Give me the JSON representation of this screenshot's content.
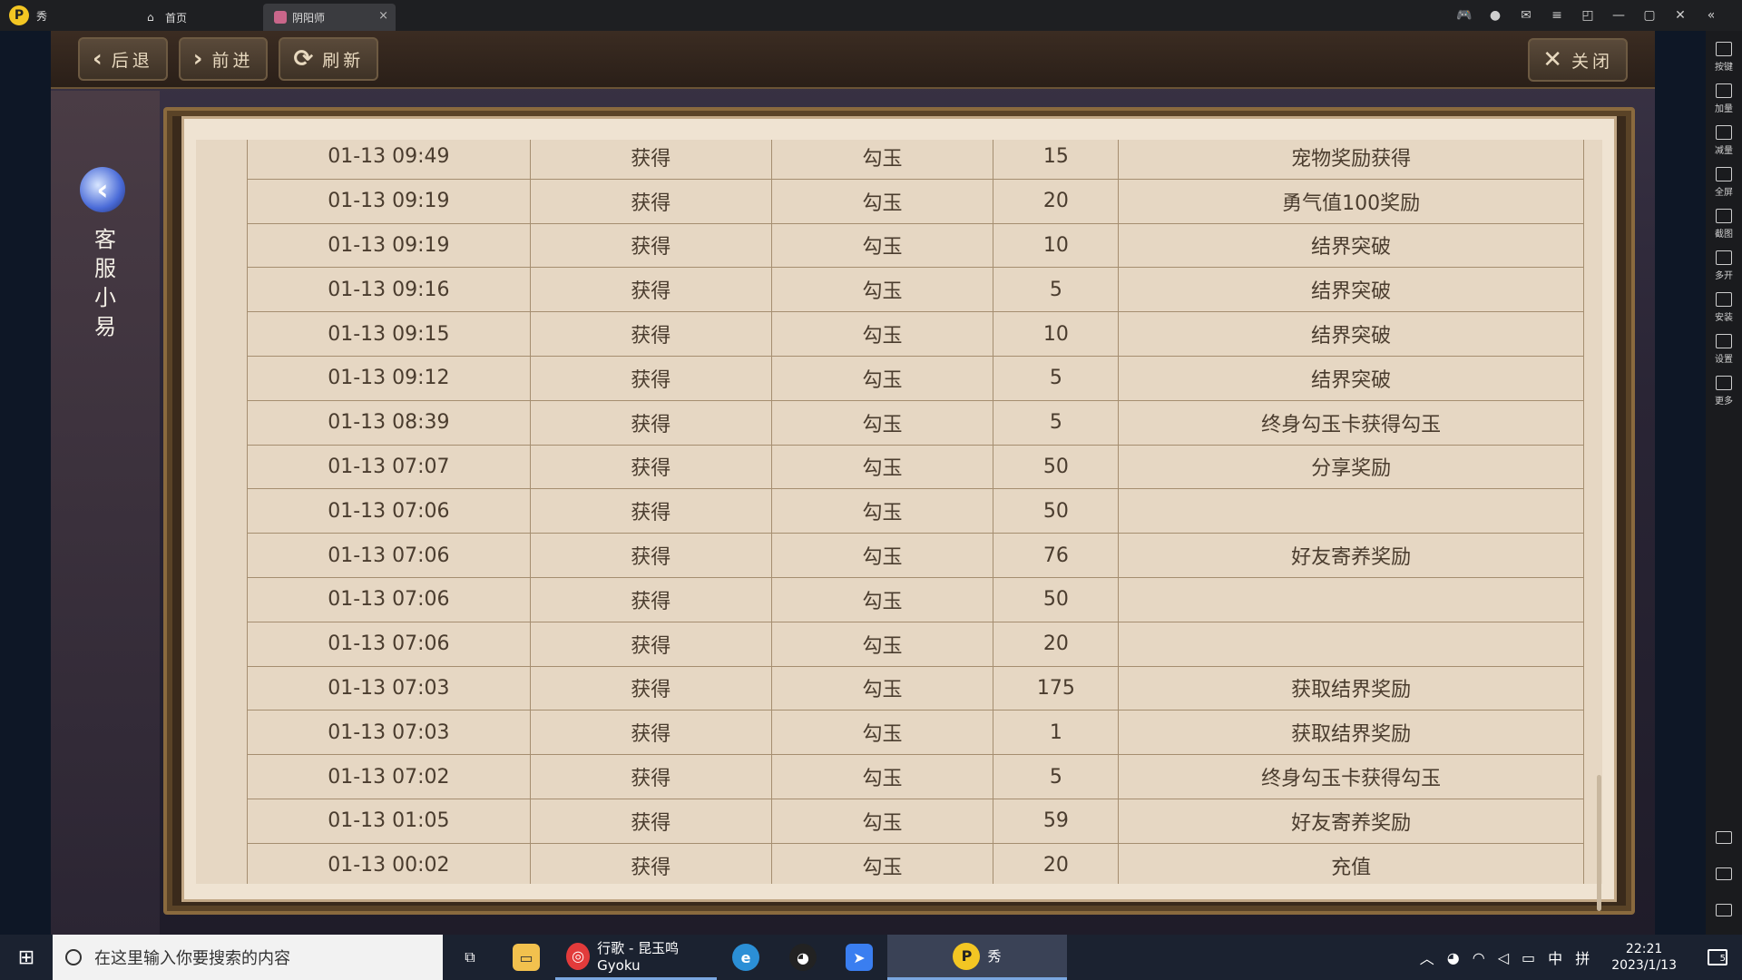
{
  "emulator": {
    "name": "秀",
    "tabs": [
      {
        "label": "首页"
      },
      {
        "label": "阴阳师"
      }
    ],
    "tab_close": "×"
  },
  "side_tools": [
    {
      "label": "按键"
    },
    {
      "label": "加量"
    },
    {
      "label": "减量"
    },
    {
      "label": "全屏"
    },
    {
      "label": "截图"
    },
    {
      "label": "多开"
    },
    {
      "label": "安装"
    },
    {
      "label": "设置"
    },
    {
      "label": "更多"
    }
  ],
  "header": {
    "back_label": "后退",
    "forward_label": "前进",
    "refresh_label": "刷新",
    "close_label": "关闭"
  },
  "left": {
    "cs_label": "客服小易"
  },
  "records": [
    [
      "01-13 09:49",
      "获得",
      "勾玉",
      "15",
      "宠物奖励获得"
    ],
    [
      "01-13 09:19",
      "获得",
      "勾玉",
      "20",
      "勇气值100奖励"
    ],
    [
      "01-13 09:19",
      "获得",
      "勾玉",
      "10",
      "结界突破"
    ],
    [
      "01-13 09:16",
      "获得",
      "勾玉",
      "5",
      "结界突破"
    ],
    [
      "01-13 09:15",
      "获得",
      "勾玉",
      "10",
      "结界突破"
    ],
    [
      "01-13 09:12",
      "获得",
      "勾玉",
      "5",
      "结界突破"
    ],
    [
      "01-13 08:39",
      "获得",
      "勾玉",
      "5",
      "终身勾玉卡获得勾玉"
    ],
    [
      "01-13 07:07",
      "获得",
      "勾玉",
      "50",
      "分享奖励"
    ],
    [
      "01-13 07:06",
      "获得",
      "勾玉",
      "50",
      ""
    ],
    [
      "01-13 07:06",
      "获得",
      "勾玉",
      "76",
      "好友寄养奖励"
    ],
    [
      "01-13 07:06",
      "获得",
      "勾玉",
      "50",
      ""
    ],
    [
      "01-13 07:06",
      "获得",
      "勾玉",
      "20",
      ""
    ],
    [
      "01-13 07:03",
      "获得",
      "勾玉",
      "175",
      "获取结界奖励"
    ],
    [
      "01-13 07:03",
      "获得",
      "勾玉",
      "1",
      "获取结界奖励"
    ],
    [
      "01-13 07:02",
      "获得",
      "勾玉",
      "5",
      "终身勾玉卡获得勾玉"
    ],
    [
      "01-13 01:05",
      "获得",
      "勾玉",
      "59",
      "好友寄养奖励"
    ],
    [
      "01-13 00:02",
      "获得",
      "勾玉",
      "20",
      "充值"
    ]
  ],
  "taskbar": {
    "search_placeholder": "在这里输入你要搜索的内容",
    "music_app": "行歌 - 昆玉鸣Gyoku",
    "emulator_app": "秀",
    "ime_lang": "中",
    "ime_mode": "拼",
    "time": "22:21",
    "date": "2023/1/13",
    "notif_count": "5"
  }
}
